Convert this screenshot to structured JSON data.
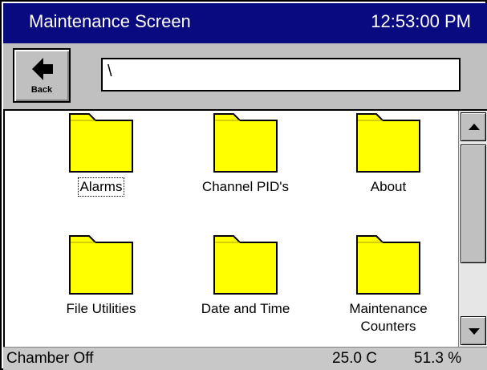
{
  "header": {
    "title": "Maintenance Screen",
    "time": "12:53:00 PM"
  },
  "toolbar": {
    "back_label": "Back",
    "path_value": "\\"
  },
  "folders": [
    {
      "label": "Alarms"
    },
    {
      "label": "Channel PID's"
    },
    {
      "label": "About"
    },
    {
      "label": "File Utilities"
    },
    {
      "label": "Date and Time"
    },
    {
      "label": "Maintenance Counters"
    }
  ],
  "status": {
    "state": "Chamber Off",
    "temperature": "25.0 C",
    "humidity": "51.3 %"
  },
  "colors": {
    "titlebar": "#0a0a80",
    "folder": "#ffff00",
    "chrome": "#c0c0c0"
  }
}
